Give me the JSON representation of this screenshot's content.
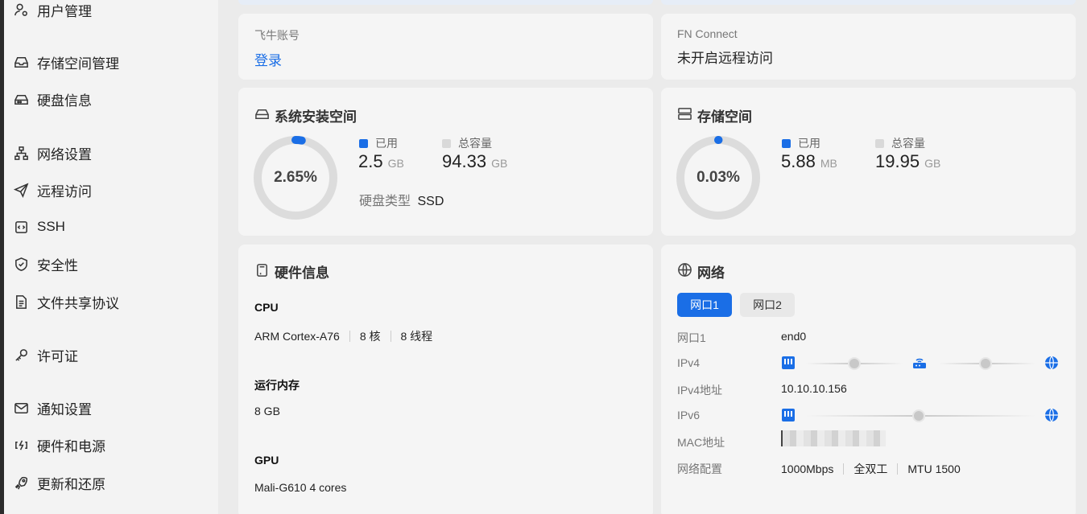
{
  "sidebar": {
    "items": [
      {
        "label": "用户管理",
        "icon": "user-settings-icon"
      },
      {
        "label": "存储空间管理",
        "icon": "storage-tray-icon"
      },
      {
        "label": "硬盘信息",
        "icon": "hard-disk-icon"
      },
      {
        "label": "网络设置",
        "icon": "network-tree-icon"
      },
      {
        "label": "远程访问",
        "icon": "paper-plane-icon"
      },
      {
        "label": "SSH",
        "icon": "code-bracket-icon"
      },
      {
        "label": "安全性",
        "icon": "shield-check-icon"
      },
      {
        "label": "文件共享协议",
        "icon": "document-icon"
      },
      {
        "label": "许可证",
        "icon": "key-icon"
      },
      {
        "label": "通知设置",
        "icon": "mail-icon"
      },
      {
        "label": "硬件和电源",
        "icon": "power-plug-icon"
      },
      {
        "label": "更新和还原",
        "icon": "rocket-icon"
      }
    ]
  },
  "account": {
    "label": "飞牛账号",
    "login": "登录"
  },
  "connect": {
    "label": "FN Connect",
    "status": "未开启远程访问"
  },
  "system_space": {
    "title": "系统安装空间",
    "percent_text": "2.65%",
    "percent": 2.65,
    "used_label": "已用",
    "used_value": "2.5",
    "used_unit": "GB",
    "total_label": "总容量",
    "total_value": "94.33",
    "total_unit": "GB",
    "disk_type_label": "硬盘类型",
    "disk_type": "SSD"
  },
  "storage_space": {
    "title": "存储空间",
    "percent_text": "0.03%",
    "percent": 0.03,
    "used_label": "已用",
    "used_value": "5.88",
    "used_unit": "MB",
    "total_label": "总容量",
    "total_value": "19.95",
    "total_unit": "GB"
  },
  "hardware": {
    "title": "硬件信息",
    "cpu_label": "CPU",
    "cpu_model": "ARM Cortex-A76",
    "cpu_cores": "8 核",
    "cpu_threads": "8 线程",
    "ram_label": "运行内存",
    "ram_value": "8 GB",
    "gpu_label": "GPU",
    "gpu_value": "Mali-G610 4 cores"
  },
  "network": {
    "title": "网络",
    "tabs": [
      "网口1",
      "网口2"
    ],
    "iface_label": "网口1",
    "iface_value": "end0",
    "ipv4_label": "IPv4",
    "ipv4_addr_label": "IPv4地址",
    "ipv4_addr": "10.10.10.156",
    "ipv6_label": "IPv6",
    "mac_label": "MAC地址",
    "config_label": "网络配置",
    "speed": "1000Mbps",
    "duplex": "全双工",
    "mtu": "MTU 1500"
  },
  "colors": {
    "accent": "#1a6ee6",
    "track": "#dcdcdc",
    "card": "#f5f5f5"
  }
}
